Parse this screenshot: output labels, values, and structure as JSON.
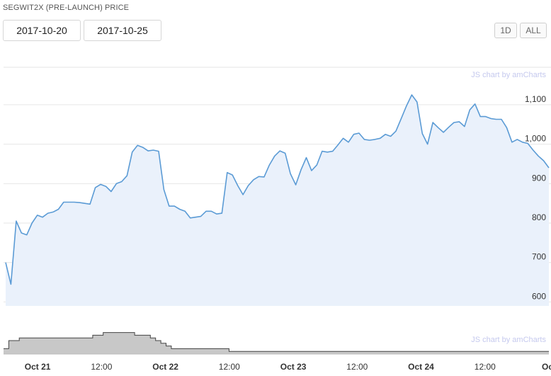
{
  "title": "SEGWIT2X (PRE-LAUNCH) PRICE",
  "date_range": {
    "from": "2017-10-20",
    "to": "2017-10-25"
  },
  "period_buttons": [
    "1D",
    "ALL"
  ],
  "credit": "JS chart by amCharts",
  "colors": {
    "line": "#5b9bd5",
    "fill": "#eaf1fb",
    "volume_fill": "#c8c8c8",
    "volume_line": "#444444",
    "grid": "#e6e6e6"
  },
  "chart_data": {
    "type": "area",
    "x_unit": "hours since Oct 20 18:00",
    "y_ticks": [
      "600",
      "700",
      "800",
      "900",
      "1,000",
      "1,100"
    ],
    "ylim": [
      590,
      1195
    ],
    "x_ticks": [
      {
        "label": "Oct 21",
        "bold": true
      },
      {
        "label": "12:00",
        "bold": false
      },
      {
        "label": "Oct 22",
        "bold": true
      },
      {
        "label": "12:00",
        "bold": false
      },
      {
        "label": "Oct 23",
        "bold": true
      },
      {
        "label": "12:00",
        "bold": false
      },
      {
        "label": "Oct 24",
        "bold": true
      },
      {
        "label": "12:00",
        "bold": false
      },
      {
        "label": "Oct",
        "bold": true
      }
    ],
    "series": [
      {
        "values": [
          700,
          645,
          805,
          775,
          770,
          800,
          820,
          815,
          825,
          828,
          835,
          853,
          853,
          853,
          852,
          850,
          848,
          890,
          898,
          893,
          880,
          900,
          905,
          920,
          980,
          997,
          992,
          983,
          985,
          982,
          885,
          843,
          843,
          835,
          830,
          813,
          815,
          817,
          830,
          830,
          823,
          825,
          928,
          922,
          895,
          872,
          895,
          910,
          918,
          917,
          947,
          970,
          983,
          977,
          925,
          897,
          935,
          966,
          933,
          947,
          982,
          980,
          982,
          998,
          1015,
          1005,
          1025,
          1028,
          1012,
          1010,
          1012,
          1015,
          1025,
          1020,
          1033,
          1065,
          1097,
          1125,
          1107,
          1027,
          1000,
          1055,
          1042,
          1030,
          1043,
          1055,
          1057,
          1045,
          1087,
          1102,
          1070,
          1070,
          1065,
          1063,
          1063,
          1042,
          1005,
          1012,
          1005,
          1002,
          985,
          970,
          958,
          940
        ]
      }
    ],
    "volume": {
      "values": [
        2,
        5,
        5,
        6,
        6,
        6,
        6,
        6,
        6,
        6,
        6,
        6,
        6,
        6,
        6,
        6,
        6,
        7,
        7,
        8,
        8,
        8,
        8,
        8,
        8,
        7,
        7,
        7,
        6,
        5,
        4,
        3,
        2,
        2,
        2,
        2,
        2,
        2,
        2,
        2,
        2,
        2,
        2,
        1,
        1,
        1,
        1,
        1,
        1,
        1,
        1,
        1,
        1,
        1,
        1,
        1,
        1,
        1,
        1,
        1,
        1,
        1,
        1,
        1,
        1,
        1,
        1,
        1,
        1,
        1,
        1,
        1,
        1,
        1,
        1,
        1,
        1,
        1,
        1,
        1,
        1,
        1,
        1,
        1,
        1,
        1,
        1,
        1,
        1,
        1,
        1,
        1,
        1,
        1,
        1,
        1,
        1,
        1,
        1,
        1,
        1,
        1,
        1,
        1
      ],
      "ylim": [
        0,
        10
      ]
    }
  }
}
